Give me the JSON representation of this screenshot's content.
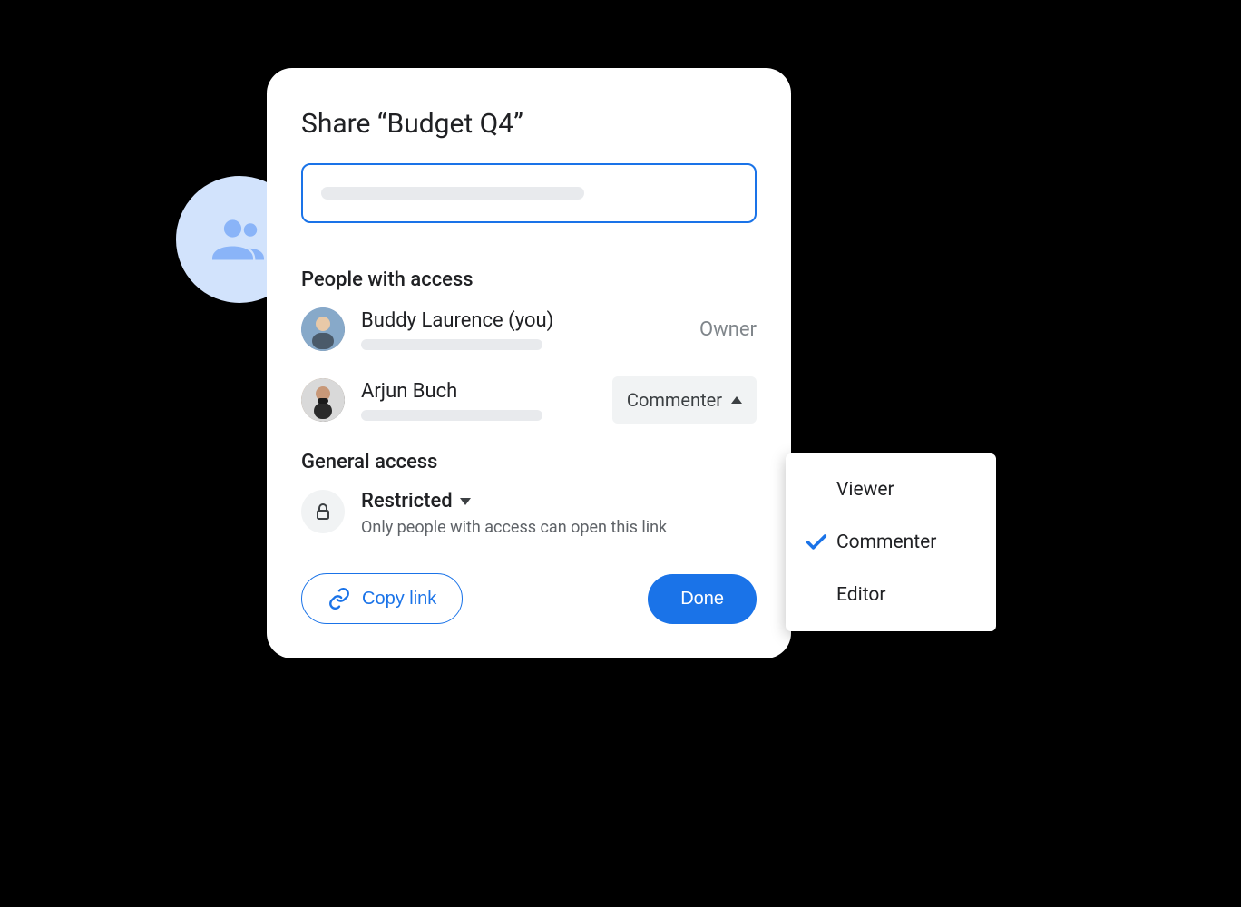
{
  "dialog": {
    "title": "Share “Budget Q4”",
    "people_section_label": "People with access",
    "general_section_label": "General access"
  },
  "people": [
    {
      "name": "Buddy Laurence (you)",
      "role": "Owner"
    },
    {
      "name": "Arjun Buch",
      "role": "Commenter"
    }
  ],
  "general": {
    "title": "Restricted",
    "description": "Only people with access can open this link"
  },
  "buttons": {
    "copy_link": "Copy link",
    "done": "Done"
  },
  "role_menu": {
    "options": [
      "Viewer",
      "Commenter",
      "Editor"
    ],
    "selected": "Commenter"
  },
  "colors": {
    "primary": "#1a73e8",
    "badge_bg": "#d2e3fc"
  }
}
